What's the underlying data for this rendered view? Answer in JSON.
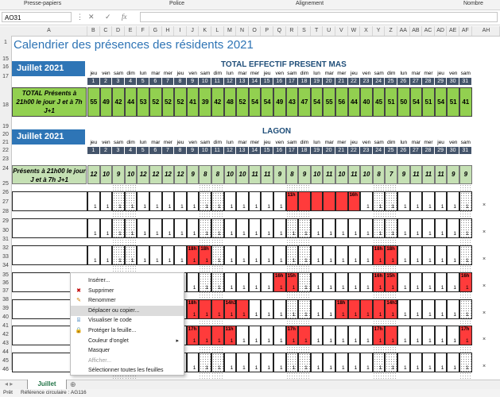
{
  "ribbon": {
    "groups": [
      "Presse-papiers",
      "Police",
      "Alignement",
      "Nombre"
    ]
  },
  "formula_bar": {
    "cell_ref": "AO31",
    "icons": [
      "more-icon",
      "cancel-icon",
      "confirm-icon",
      "function-icon"
    ]
  },
  "columns": [
    "A",
    "B",
    "C",
    "D",
    "E",
    "F",
    "G",
    "H",
    "I",
    "J",
    "K",
    "L",
    "M",
    "N",
    "O",
    "P",
    "Q",
    "R",
    "S",
    "T",
    "U",
    "V",
    "W",
    "X",
    "Y",
    "Z",
    "AA",
    "AB",
    "AC",
    "AD",
    "AE",
    "AF",
    "AH"
  ],
  "rows": [
    "1",
    "15",
    "16",
    "17",
    "18",
    "19",
    "20",
    "21",
    "22",
    "23",
    "24",
    "25",
    "26",
    "27",
    "28",
    "29",
    "30",
    "31",
    "32",
    "33",
    "34",
    "35",
    "36",
    "37",
    "38",
    "39",
    "40",
    "41",
    "42",
    "43",
    "44",
    "45",
    "46"
  ],
  "title": "Calendrier des présences des résidents 2021",
  "month": "Juillet 2021",
  "sections": {
    "total": "TOTAL EFFECTIF PRESENT MAS",
    "lagon": "LAGON"
  },
  "day_names": [
    "jeu",
    "ven",
    "sam",
    "dim",
    "lun",
    "mar",
    "mer",
    "jeu",
    "ven",
    "sam",
    "dim",
    "lun",
    "mar",
    "mer",
    "jeu",
    "ven",
    "sam",
    "dim",
    "lun",
    "mar",
    "mer",
    "jeu",
    "ven",
    "sam",
    "dim",
    "lun",
    "mar",
    "mer",
    "jeu",
    "ven",
    "sam"
  ],
  "day_numbers": [
    "1",
    "2",
    "3",
    "4",
    "5",
    "6",
    "7",
    "8",
    "9",
    "10",
    "11",
    "12",
    "13",
    "14",
    "15",
    "16",
    "17",
    "18",
    "19",
    "20",
    "21",
    "22",
    "23",
    "24",
    "25",
    "26",
    "27",
    "28",
    "29",
    "30",
    "31"
  ],
  "total_label": "TOTAL Présents à 21h00 le jour J et à 7h J+1",
  "total_values": [
    "55",
    "49",
    "42",
    "44",
    "53",
    "52",
    "52",
    "52",
    "41",
    "39",
    "42",
    "48",
    "52",
    "54",
    "54",
    "49",
    "43",
    "47",
    "54",
    "55",
    "56",
    "44",
    "40",
    "45",
    "51",
    "50",
    "54",
    "51",
    "54",
    "51",
    "41"
  ],
  "lagon_label": "Présents à 21h00 le jour J et à 7h J+1",
  "lagon_values": [
    "12",
    "10",
    "9",
    "10",
    "12",
    "12",
    "12",
    "12",
    "9",
    "8",
    "8",
    "10",
    "10",
    "11",
    "11",
    "9",
    "8",
    "9",
    "10",
    "11",
    "10",
    "11",
    "10",
    "8",
    "7",
    "9",
    "11",
    "11",
    "11",
    "9",
    "9"
  ],
  "residents": [
    {
      "present": [
        1,
        1,
        1,
        1,
        1,
        1,
        1,
        1,
        1,
        1,
        1,
        1,
        1,
        1,
        1,
        1,
        0,
        0,
        0,
        0,
        0,
        0,
        1,
        1,
        1,
        1,
        1,
        1,
        1,
        1,
        1
      ],
      "red": [
        17,
        18,
        19,
        20,
        21,
        22
      ],
      "times": {
        "17": "11h",
        "22": "16h"
      }
    },
    {
      "present": [
        1,
        1,
        1,
        1,
        1,
        1,
        1,
        1,
        1,
        1,
        1,
        1,
        1,
        1,
        1,
        1,
        1,
        1,
        1,
        1,
        1,
        1,
        1,
        1,
        1,
        1,
        1,
        1,
        1,
        1,
        1
      ],
      "red": [],
      "times": {}
    },
    {
      "present": [
        1,
        1,
        1,
        1,
        1,
        1,
        1,
        1,
        1,
        1,
        1,
        1,
        1,
        1,
        1,
        1,
        1,
        1,
        1,
        1,
        1,
        1,
        1,
        1,
        1,
        1,
        1,
        1,
        1,
        1,
        1
      ],
      "red": [
        9,
        10,
        24,
        25
      ],
      "times": {
        "9": "18h",
        "10": "18h",
        "24": "18h",
        "25": "18h"
      }
    },
    {
      "present": [
        1,
        1,
        1,
        1,
        1,
        1,
        1,
        1,
        1,
        1,
        1,
        1,
        1,
        1,
        1,
        1,
        1,
        1,
        1,
        1,
        1,
        1,
        1,
        1,
        1,
        1,
        1,
        1,
        1,
        1,
        1
      ],
      "red": [
        16,
        17,
        24,
        25,
        31
      ],
      "times": {
        "16": "16h",
        "17": "15h",
        "24": "16h",
        "25": "15h",
        "31": "16h"
      }
    },
    {
      "present": [
        1,
        1,
        1,
        1,
        1,
        1,
        1,
        1,
        1,
        1,
        1,
        1,
        1,
        1,
        1,
        1,
        1,
        1,
        1,
        1,
        1,
        1,
        1,
        1,
        1,
        1,
        1,
        1,
        1,
        1,
        1
      ],
      "red": [
        9,
        10,
        11,
        12,
        13,
        21,
        22,
        23,
        24,
        25
      ],
      "times": {
        "9": "18h",
        "12": "14h30",
        "21": "18h",
        "25": "14h30"
      }
    },
    {
      "present": [
        1,
        1,
        1,
        1,
        1,
        1,
        1,
        1,
        1,
        1,
        1,
        1,
        1,
        1,
        1,
        1,
        1,
        1,
        1,
        1,
        1,
        1,
        1,
        1,
        1,
        1,
        1,
        1,
        1,
        1,
        1
      ],
      "red": [
        9,
        10,
        11,
        12,
        17,
        18,
        24,
        25,
        31
      ],
      "times": {
        "9": "17h",
        "12": "11h",
        "17": "17h",
        "24": "17h",
        "31": "17h"
      }
    },
    {
      "present": [
        1,
        1,
        1,
        1,
        1,
        1,
        1,
        1,
        1,
        1,
        1,
        1,
        1,
        1,
        1,
        1,
        1,
        1,
        1,
        1,
        1,
        1,
        1,
        1,
        1,
        1,
        1,
        1,
        1,
        1,
        1
      ],
      "red": [],
      "times": {}
    }
  ],
  "context_menu": {
    "items": [
      {
        "label": "Insérer...",
        "icon": "",
        "disabled": false,
        "hl": false,
        "arrow": false
      },
      {
        "label": "Supprimer",
        "icon": "delete-sheet-icon",
        "disabled": false,
        "hl": false,
        "arrow": false
      },
      {
        "label": "Renommer",
        "icon": "rename-icon",
        "disabled": false,
        "hl": false,
        "arrow": false
      },
      {
        "label": "Déplacer ou copier...",
        "icon": "",
        "disabled": false,
        "hl": true,
        "arrow": false
      },
      {
        "label": "Visualiser le code",
        "icon": "view-code-icon",
        "disabled": false,
        "hl": false,
        "arrow": false
      },
      {
        "label": "Protéger la feuille...",
        "icon": "protect-sheet-icon",
        "disabled": false,
        "hl": false,
        "arrow": false
      },
      {
        "label": "Couleur d'onglet",
        "icon": "",
        "disabled": false,
        "hl": false,
        "arrow": true
      },
      {
        "label": "Masquer",
        "icon": "",
        "disabled": false,
        "hl": false,
        "arrow": false
      },
      {
        "label": "Afficher...",
        "icon": "",
        "disabled": true,
        "hl": false,
        "arrow": false
      },
      {
        "label": "Sélectionner toutes les feuilles",
        "icon": "",
        "disabled": false,
        "hl": false,
        "arrow": false
      }
    ]
  },
  "sheet_tab": "Juillet",
  "status": {
    "ready": "Prêt",
    "circular": "Référence circulaire : AG116"
  },
  "x_mark": "×",
  "present_mark": "1"
}
